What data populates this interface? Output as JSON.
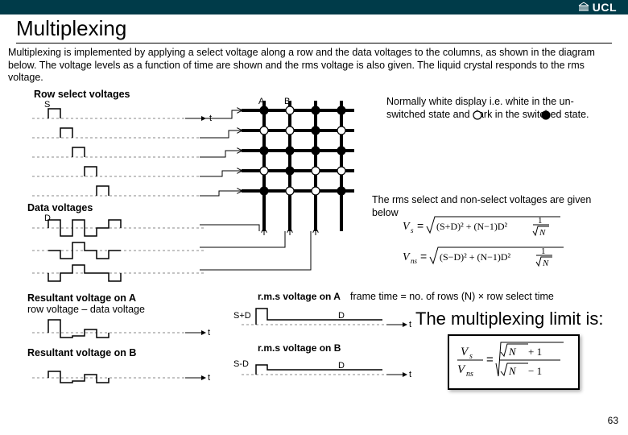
{
  "header": {
    "logo": "UCL"
  },
  "title": "Multiplexing",
  "intro": "Multiplexing is implemented by applying a select voltage along a row and the data voltages to the columns, as shown in the diagram below.  The voltage levels as a function of time are shown and the rms voltage is also given.  The liquid crystal responds to the rms voltage.",
  "labels": {
    "row_select": "Row select voltages",
    "S": "S",
    "t": "t",
    "data_voltages": "Data voltages",
    "D": "D",
    "resA": "Resultant voltage on A",
    "resA_sub": "row voltage – data voltage",
    "resB": "Resultant voltage on B",
    "rmsA": "r.m.s voltage on A",
    "rmsB": "r.m.s voltage on B",
    "S_plus_D": "S+D",
    "S_minus_D": "S-D",
    "frame": "frame time = no. of rows (N) × row select time",
    "A": "A",
    "B": "B"
  },
  "side": {
    "normally_white": "Normally white display i.e. white in the un-switched state        and dark       in the switched state.",
    "rms_given": "The rms select and non-select voltages are given below"
  },
  "equations": {
    "vs": "Vs = √((S+D)² + (N−1)D²) / √N",
    "vns": "Vns = √((S−D)² + (N−1)D²) / √N",
    "ml_limit_text": "The multiplexing limit is:",
    "ratio": "Vs / Vns = (√N + 1) / (√N − 1)"
  },
  "page_number": "63"
}
